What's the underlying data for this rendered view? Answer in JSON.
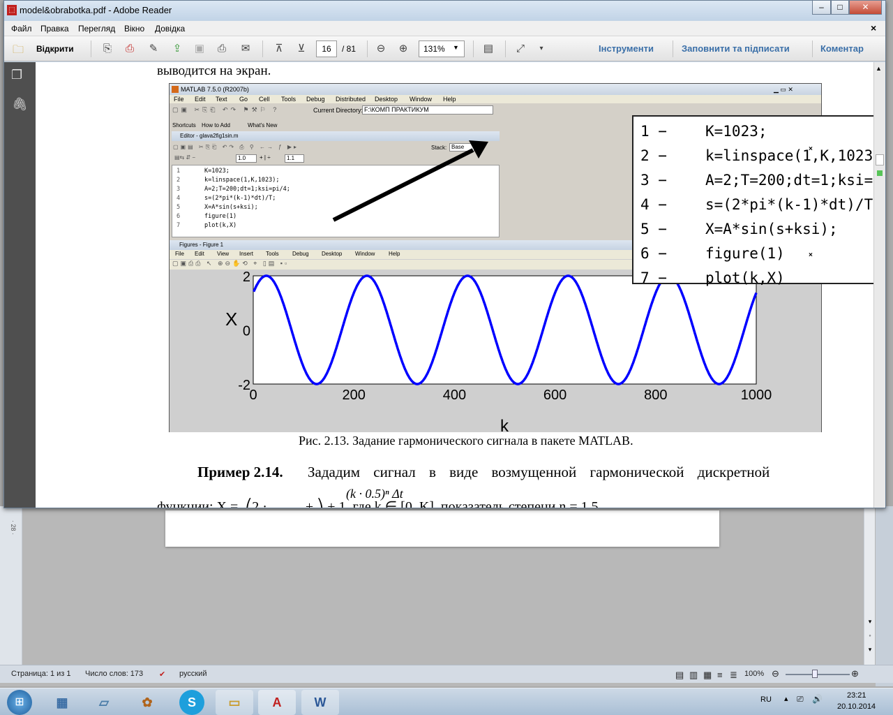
{
  "colors": {
    "reader_accent": "#3a6fa8",
    "plot_line": "#0000ff",
    "pdf_red": "#c0201e"
  },
  "window": {
    "title": "model&obrabotka.pdf - Adobe Reader",
    "min": "–",
    "max": "□",
    "close": "✕"
  },
  "menu": [
    "Файл",
    "Правка",
    "Перегляд",
    "Вікно",
    "Довідка"
  ],
  "menu_close": "×",
  "toolbar": {
    "open": "Відкрити",
    "page_current": "16",
    "page_total": "/ 81",
    "zoom": "131%",
    "tools": "Інструменти",
    "fill_sign": "Заповнити та підписати",
    "comment": "Коментар"
  },
  "doc": {
    "top_text": "выводится на экран.",
    "caption": "Рис. 2.13. Задание гармонического сигнала в пакете MATLAB.",
    "example_bold": "Пример 2.14.",
    "example_text": "Зададим сигнал в виде возмущенной гармонической дискретной",
    "formula_top": "(k · 0.5)ⁿ Δt",
    "formula_bottom": "функции: X =  ⎛2 ·           + ⎞ + 1, где k ∈ [0, K], показатель степени n = 1.5"
  },
  "matlab": {
    "title": "MATLAB 7.5.0 (R2007b)",
    "menu": [
      "File",
      "Edit",
      "Text",
      "Go",
      "Cell",
      "Tools",
      "Debug",
      "Distributed",
      "Desktop",
      "Window",
      "Help"
    ],
    "cur_dir_label": "Current Directory:",
    "cur_dir": "F:\\КОМП ПРАКТИКУМ",
    "shortcuts": [
      "Shortcuts",
      "How to Add",
      "What's New"
    ],
    "editor_title": "Editor - glava2fig1sin.m",
    "stack_label": "Stack:",
    "stack_value": "Base",
    "zoom_a": "1.0",
    "zoom_b": "1.1",
    "code_numbers": [
      "1",
      "2",
      "3",
      "4",
      "5",
      "6",
      "7"
    ],
    "code": [
      "K=1023;",
      "k=linspace(1,K,1023);",
      "A=2;T=200;dt=1;ksi=pi/4;",
      "s=(2*pi*(k-1)*dt)/T;",
      "X=A*sin(s+ksi);",
      "figure(1)",
      "plot(k,X)"
    ],
    "figure_title": "Figures - Figure 1",
    "figure_menu": [
      "File",
      "Edit",
      "View",
      "Insert",
      "Tools",
      "Debug",
      "Desktop",
      "Window",
      "Help"
    ]
  },
  "chart_data": {
    "type": "line",
    "title": "",
    "xlabel": "k",
    "ylabel": "X",
    "xlim": [
      0,
      1000
    ],
    "ylim": [
      -2,
      2
    ],
    "xticks": [
      "0",
      "200",
      "400",
      "600",
      "800",
      "1000"
    ],
    "yticks": [
      "2",
      "0",
      "-2"
    ],
    "grid": false,
    "series": [
      {
        "amplitude": 2,
        "period": 200,
        "phase": 0.7854,
        "x_start": 1,
        "x_end": 1000
      }
    ]
  },
  "word": {
    "status_page": "Страница: 1 из 1",
    "status_words": "Число слов: 173",
    "status_lang": "русский",
    "zoom": "100%",
    "ruler": "· 28 ·"
  },
  "taskbar": {
    "lang": "RU",
    "time": "23:21",
    "date": "20.10.2014"
  }
}
